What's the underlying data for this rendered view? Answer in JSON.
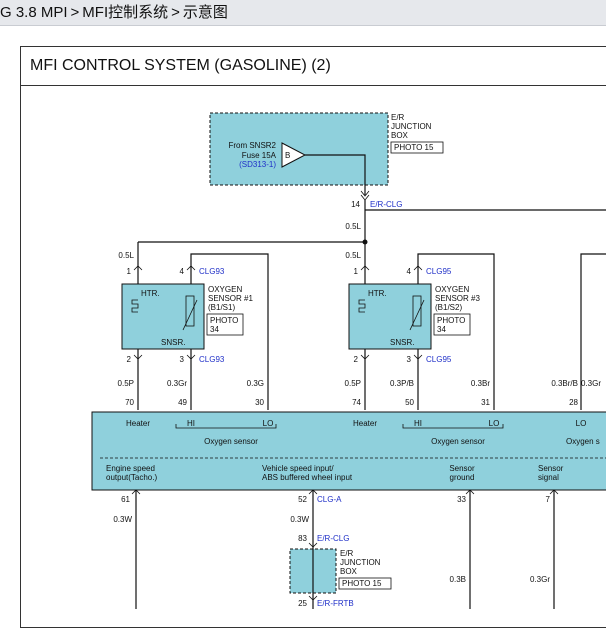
{
  "breadcrumb": {
    "items": [
      "G 3.8 MPI",
      "MFI控制系统",
      "示意图"
    ],
    "separator": ">"
  },
  "diagram": {
    "title": "MFI CONTROL SYSTEM (GASOLINE) (2)",
    "top_junction_box": {
      "name_lines": [
        "E/R",
        "JUNCTION",
        "BOX"
      ],
      "photo": "PHOTO 15",
      "source_lines": [
        "From SNSR2",
        "Fuse 15A"
      ],
      "ref": "(SD313-1)",
      "fuse_letter": "B",
      "pin": "14",
      "connector": "E/R-CLG"
    },
    "wire_top": "0.5L",
    "sensor1": {
      "htr": "HTR.",
      "snsr": "SNSR.",
      "name_lines": [
        "OXYGEN",
        "SENSOR #1",
        "(B1/S1)"
      ],
      "photo_lines": [
        "PHOTO",
        "34"
      ],
      "wire_in": "0.5L",
      "pin1": "1",
      "pin4": "4",
      "pin2": "2",
      "pin3": "3",
      "conn_top": "CLG93",
      "conn_bottom": "CLG93",
      "wires": [
        "0.5P",
        "0.3Gr",
        "0.3G"
      ],
      "ecm_pins": [
        "70",
        "49",
        "30"
      ]
    },
    "sensor3": {
      "htr": "HTR.",
      "snsr": "SNSR.",
      "name_lines": [
        "OXYGEN",
        "SENSOR #3",
        "(B1/S2)"
      ],
      "photo_lines": [
        "PHOTO",
        "34"
      ],
      "wire_in": "0.5L",
      "pin1": "1",
      "pin4": "4",
      "pin2": "2",
      "pin3": "3",
      "conn_top": "CLG95",
      "conn_bottom": "CLG95",
      "wires": [
        "0.5P",
        "0.3P/B",
        "0.3Br"
      ],
      "ecm_pins": [
        "74",
        "50",
        "31"
      ]
    },
    "sensor_right": {
      "wires": [
        "0.3Br/B",
        "0.3Gr"
      ],
      "ecm_pin": "28"
    },
    "ecm": {
      "heater_1": "Heater",
      "hi_1": "HI",
      "lo_1": "LO",
      "oxy_1": "Oxygen sensor",
      "heater_2": "Heater",
      "hi_2": "HI",
      "lo_2": "LO",
      "oxy_2": "Oxygen sensor",
      "lo_3": "LO",
      "oxy_3": "Oxygen s",
      "engine_speed_lines": [
        "Engine speed",
        "output(Tacho.)"
      ],
      "vehicle_speed_lines": [
        "Vehicle speed input/",
        "ABS buffered wheel input"
      ],
      "sensor_ground_lines": [
        "Sensor",
        "ground"
      ],
      "sensor_signal_lines": [
        "Sensor",
        "signal"
      ]
    },
    "bottom": {
      "pin61": "61",
      "wire61": "0.3W",
      "pin52": "52",
      "conn52": "CLG-A",
      "wire52": "0.3W",
      "pin83": "83",
      "conn83": "E/R-CLG",
      "jb_lines": [
        "E/R",
        "JUNCTION",
        "BOX"
      ],
      "jb_photo": "PHOTO 15",
      "pin25": "25",
      "conn25": "E/R-FRTB",
      "pin33": "33",
      "wire33": "0.3B",
      "pin7": "7",
      "wire7": "0.3Gr"
    },
    "colors": {
      "box_fill": "#8fd0dc",
      "ecm_fill": "#8fd0dc",
      "connector_text": "#1f2fc8",
      "line": "#111111"
    }
  }
}
